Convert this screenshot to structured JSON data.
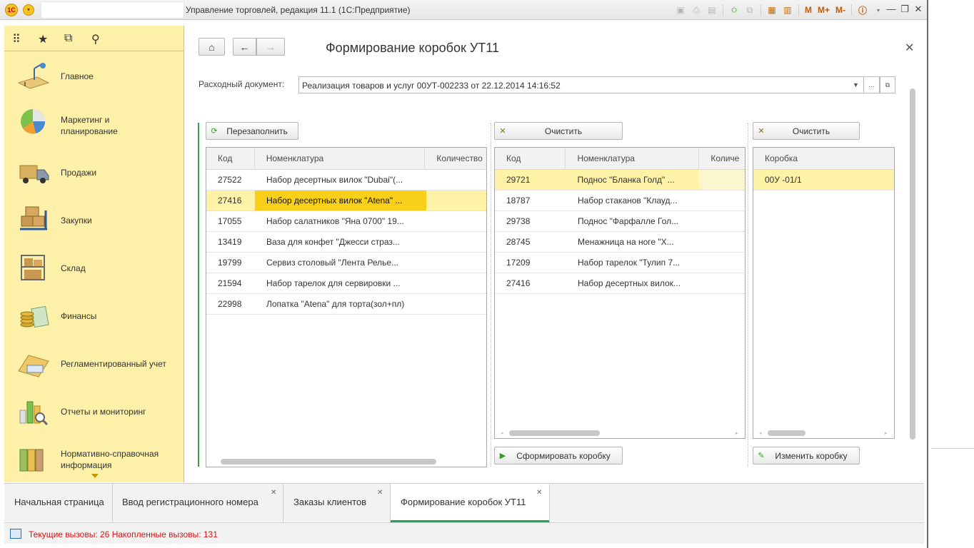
{
  "titlebar": {
    "logo_text": "1С",
    "title": "Управление торговлей, редакция 11.1  (1С:Предприятие)",
    "memo_buttons": [
      "M",
      "M+",
      "M-"
    ]
  },
  "sidebar": {
    "items": [
      {
        "label": "Главное",
        "icon": "desk-lamp-icon"
      },
      {
        "label": "Маркетинг и планирование",
        "icon": "pie-chart-icon"
      },
      {
        "label": "Продажи",
        "icon": "truck-icon"
      },
      {
        "label": "Закупки",
        "icon": "boxes-cart-icon"
      },
      {
        "label": "Склад",
        "icon": "warehouse-shelf-icon"
      },
      {
        "label": "Финансы",
        "icon": "coins-icon"
      },
      {
        "label": "Регламентированный учет",
        "icon": "folder-docs-icon"
      },
      {
        "label": "Отчеты и мониторинг",
        "icon": "bar-chart-magnifier-icon"
      },
      {
        "label": "Нормативно-справочная информация",
        "icon": "binders-icon"
      }
    ]
  },
  "form": {
    "title": "Формирование коробок УТ11",
    "doc_label": "Расходный документ:",
    "doc_value": "Реализация товаров и услуг 00УТ-002233 от 22.12.2014 14:16:52",
    "refill_button": "Перезаполнить",
    "clear_button_1": "Очистить",
    "clear_button_2": "Очистить",
    "form_box_button": "Сформировать коробку",
    "change_box_button": "Изменить коробку"
  },
  "table_left": {
    "columns": [
      "Код",
      "Номенклатура",
      "Количество"
    ],
    "rows": [
      {
        "code": "27522",
        "name": "Набор десертных вилок \"Dubai\"(..."
      },
      {
        "code": "27416",
        "name": "Набор десертных вилок \"Atena\" ..."
      },
      {
        "code": "17055",
        "name": "Набор салатников \"Яна 0700\" 19..."
      },
      {
        "code": "13419",
        "name": "Ваза для конфет \"Джесси страз..."
      },
      {
        "code": "19799",
        "name": "Сервиз столовый \"Лента Релье..."
      },
      {
        "code": "21594",
        "name": "Набор тарелок для сервировки ..."
      },
      {
        "code": "22998",
        "name": "Лопатка \"Atena\" для торта(зол+пл)"
      }
    ]
  },
  "table_mid": {
    "columns": [
      "Код",
      "Номенклатура",
      "Количе"
    ],
    "rows": [
      {
        "code": "29721",
        "name": "Поднос \"Бланка Голд\" ..."
      },
      {
        "code": "18787",
        "name": "Набор стаканов \"Клауд..."
      },
      {
        "code": "29738",
        "name": "Поднос \"Фарфалле Гол..."
      },
      {
        "code": "28745",
        "name": "Менажница на ноге  \"Х..."
      },
      {
        "code": "17209",
        "name": "Набор тарелок \"Тулип 7..."
      },
      {
        "code": "27416",
        "name": "Набор десертных вилок..."
      }
    ]
  },
  "table_right": {
    "columns": [
      "Коробка"
    ],
    "rows": [
      {
        "box": "00У -01/1"
      }
    ]
  },
  "tabs": [
    {
      "label": "Начальная страница",
      "closable": false
    },
    {
      "label": "Ввод регистрационного номера",
      "closable": true
    },
    {
      "label": "Заказы клиентов",
      "closable": true
    },
    {
      "label": "Формирование коробок УТ11",
      "closable": true,
      "active": true
    }
  ],
  "status": {
    "text": "Текущие вызовы: 26   Накопленные вызовы: 131"
  },
  "colors": {
    "sidebar_bg": "#fdf0a8",
    "selection": "#fdf2a6",
    "current_cell": "#f8cf19",
    "accent_green": "#23a35a",
    "status_red": "#dd1111"
  }
}
